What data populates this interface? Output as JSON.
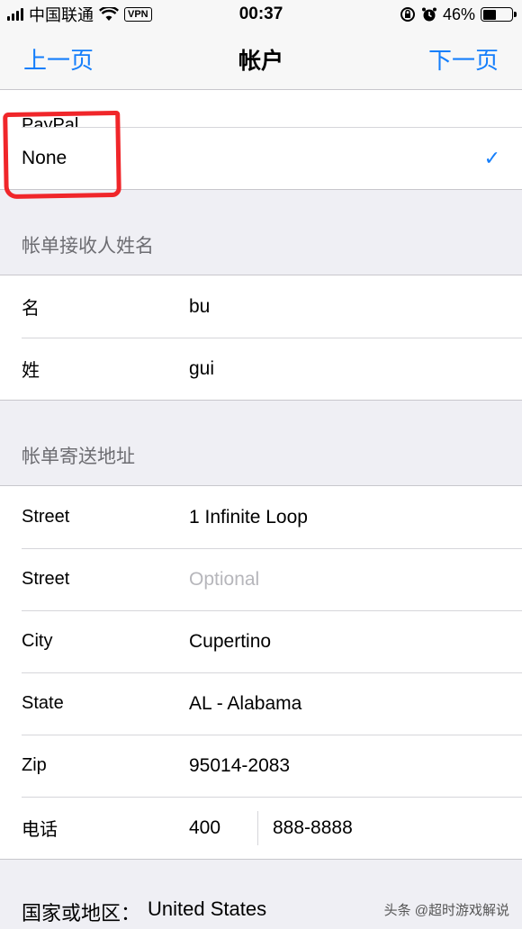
{
  "status_bar": {
    "carrier": "中国联通",
    "vpn": "VPN",
    "time": "00:37",
    "battery": "46%",
    "battery_level": 0.46
  },
  "nav": {
    "back": "上一页",
    "title": "帐户",
    "next": "下一页"
  },
  "payment": {
    "paypal": "PayPal",
    "none": "None",
    "check": "✓"
  },
  "billing_name": {
    "header": "帐单接收人姓名",
    "rows": [
      {
        "label": "名",
        "value": "bu"
      },
      {
        "label": "姓",
        "value": "gui"
      }
    ]
  },
  "billing_address": {
    "header": "帐单寄送地址",
    "street1_label": "Street",
    "street1_value": "1 Infinite Loop",
    "street2_label": "Street",
    "street2_placeholder": "Optional",
    "city_label": "City",
    "city_value": "Cupertino",
    "state_label": "State",
    "state_value": "AL - Alabama",
    "zip_label": "Zip",
    "zip_value": "95014-2083",
    "phone_label": "电话",
    "phone_area": "400",
    "phone_number": "888-8888"
  },
  "country": {
    "label": "国家或地区：",
    "value": "United States"
  },
  "watermark": "头条 @超时游戏解说",
  "colors": {
    "accent": "#147efb",
    "annotation": "#f0262a"
  }
}
